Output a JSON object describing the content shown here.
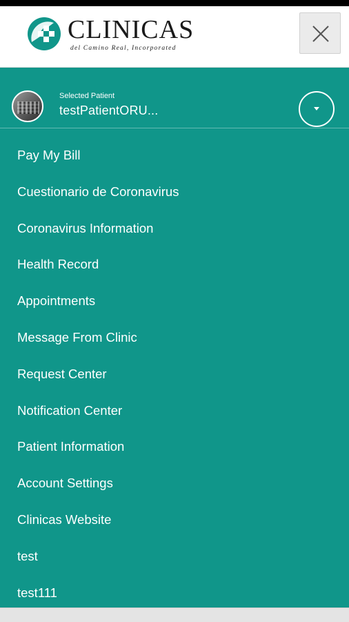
{
  "header": {
    "logo": {
      "wordmark": "CLINICAS",
      "subtitle": "del Camino Real, Incorporated",
      "mark_colors": [
        "#10968a",
        "#ffffff"
      ]
    },
    "close_icon": "close-icon"
  },
  "patient": {
    "caption": "Selected Patient",
    "name": "testPatientORU...",
    "toggle_icon": "chevron-down-icon"
  },
  "menu": {
    "items": [
      {
        "label": "Pay My Bill"
      },
      {
        "label": "Cuestionario de Coronavirus"
      },
      {
        "label": "Coronavirus Information"
      },
      {
        "label": "Health Record"
      },
      {
        "label": "Appointments"
      },
      {
        "label": "Message From Clinic"
      },
      {
        "label": "Request Center"
      },
      {
        "label": "Notification Center"
      },
      {
        "label": "Patient Information"
      },
      {
        "label": "Account Settings"
      },
      {
        "label": "Clinicas Website"
      },
      {
        "label": "test"
      },
      {
        "label": "test111"
      }
    ]
  },
  "colors": {
    "drawer_bg": "#10968a",
    "header_bg": "#ffffff",
    "text_on_drawer": "#ffffff"
  }
}
